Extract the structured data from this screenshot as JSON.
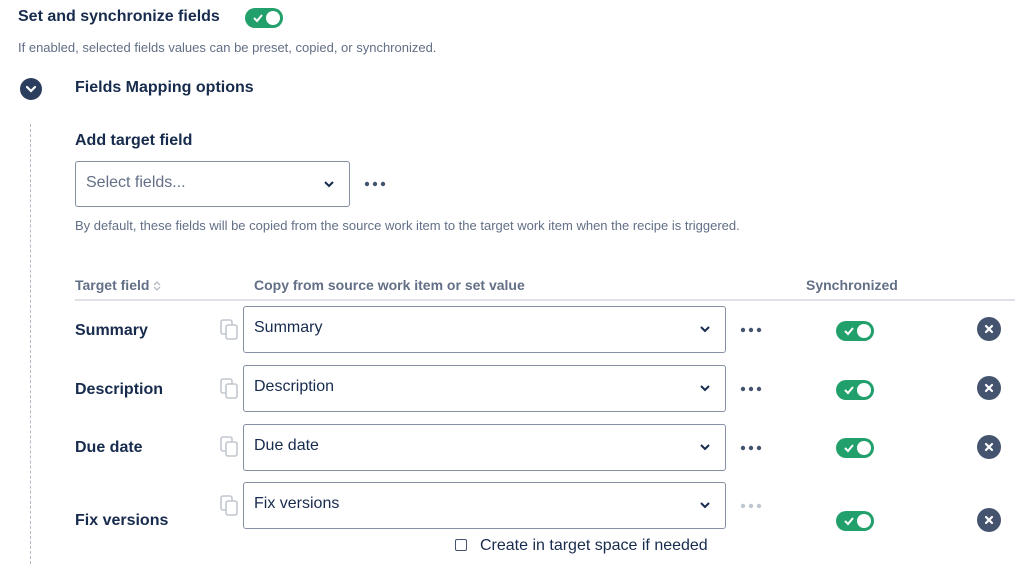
{
  "header": {
    "title": "Set and synchronize fields",
    "description": "If enabled, selected fields values can be preset, copied, or synchronized.",
    "enabled": true
  },
  "section": {
    "title": "Fields Mapping options"
  },
  "add_target": {
    "label": "Add target field",
    "placeholder": "Select fields...",
    "hint": "By default, these fields will be copied from the source work item to the target work item when the recipe is triggered."
  },
  "table": {
    "columns": {
      "target": "Target field",
      "copy": "Copy from source work item or set value",
      "sync": "Synchronized"
    },
    "rows": [
      {
        "label": "Summary",
        "value": "Summary",
        "synchronized": true
      },
      {
        "label": "Description",
        "value": "Description",
        "synchronized": true
      },
      {
        "label": "Due date",
        "value": "Due date",
        "synchronized": true
      },
      {
        "label": "Fix versions",
        "value": "Fix versions",
        "synchronized": true,
        "create_option": "Create in target space if needed",
        "create_checked": false
      }
    ]
  },
  "icons": {
    "toggle_check": "check-icon",
    "expand": "chevron-down-icon",
    "more": "more-horizontal-icon",
    "copy": "copy-icon",
    "remove": "close-circle-icon",
    "sort": "sort-icon"
  },
  "colors": {
    "toggle_on": "#22a06b",
    "text": "#172b4d",
    "subtle": "#626f86",
    "dark_icon": "#44546f"
  }
}
